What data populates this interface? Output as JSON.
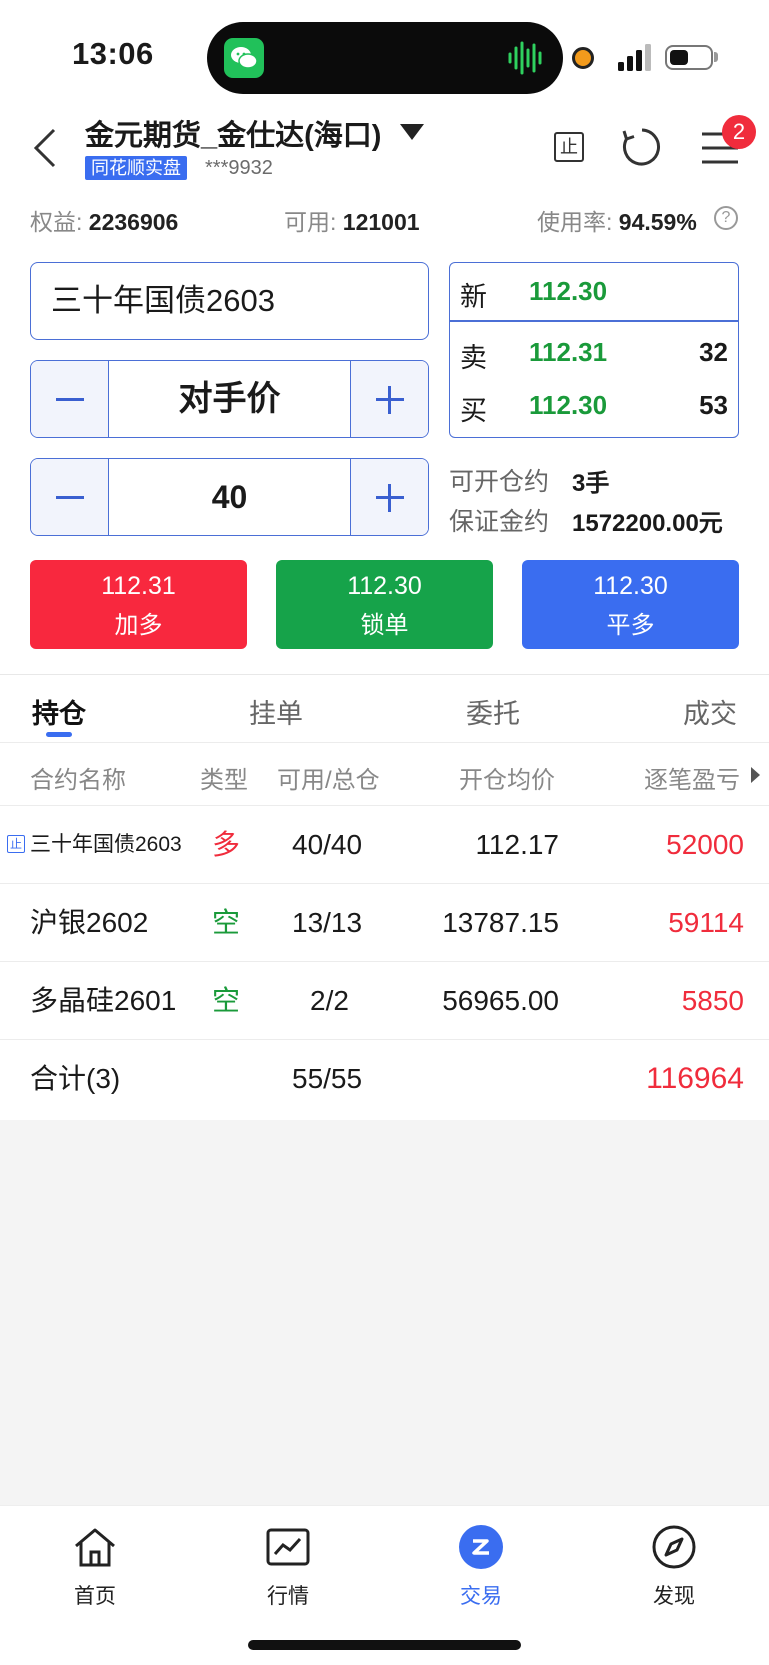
{
  "status_bar": {
    "time": "13:06"
  },
  "header": {
    "account_title": "金元期货_金仕达(海口)",
    "platform_tag": "同花顺实盘",
    "account_number": "***9932",
    "stop_icon_label": "止",
    "notification_count": "2"
  },
  "summary": {
    "equity_label": "权益:",
    "equity_value": "2236906",
    "available_label": "可用:",
    "available_value": "121001",
    "usage_label": "使用率:",
    "usage_value": "94.59%",
    "help_glyph": "?"
  },
  "order": {
    "contract": "三十年国债2603",
    "price_mode": "对手价",
    "quantity": "40"
  },
  "quote": {
    "last_label": "新",
    "last_price": "112.30",
    "ask_label": "卖",
    "ask_price": "112.31",
    "ask_volume": "32",
    "bid_label": "买",
    "bid_price": "112.30",
    "bid_volume": "53"
  },
  "info": {
    "openable_label": "可开仓约",
    "openable_value": "3手",
    "margin_label": "保证金约",
    "margin_value": "1572200.00元"
  },
  "actions": [
    {
      "price": "112.31",
      "label": "加多",
      "color": "#f8283e"
    },
    {
      "price": "112.30",
      "label": "锁单",
      "color": "#16a34a"
    },
    {
      "price": "112.30",
      "label": "平多",
      "color": "#3a6df0"
    }
  ],
  "tabs": [
    "持仓",
    "挂单",
    "委托",
    "成交"
  ],
  "table": {
    "headers": [
      "合约名称",
      "类型",
      "可用/总仓",
      "开仓均价",
      "逐笔盈亏"
    ],
    "rows": [
      {
        "stop_tag": "止",
        "name": "三十年国债2603",
        "type": "多",
        "avail_total": "40/40",
        "avg_price": "112.17",
        "pnl": "52000"
      },
      {
        "name": "沪银2602",
        "type": "空",
        "avail_total": "13/13",
        "avg_price": "13787.15",
        "pnl": "59114"
      },
      {
        "name": "多晶硅2601",
        "type": "空",
        "avail_total": "2/2",
        "avg_price": "56965.00",
        "pnl": "5850"
      }
    ],
    "total": {
      "name": "合计(3)",
      "avail_total": "55/55",
      "pnl": "116964"
    }
  },
  "nav": [
    {
      "label": "首页",
      "icon": "home-icon"
    },
    {
      "label": "行情",
      "icon": "chart-icon"
    },
    {
      "label": "交易",
      "icon": "trade-icon"
    },
    {
      "label": "发现",
      "icon": "compass-icon"
    }
  ]
}
